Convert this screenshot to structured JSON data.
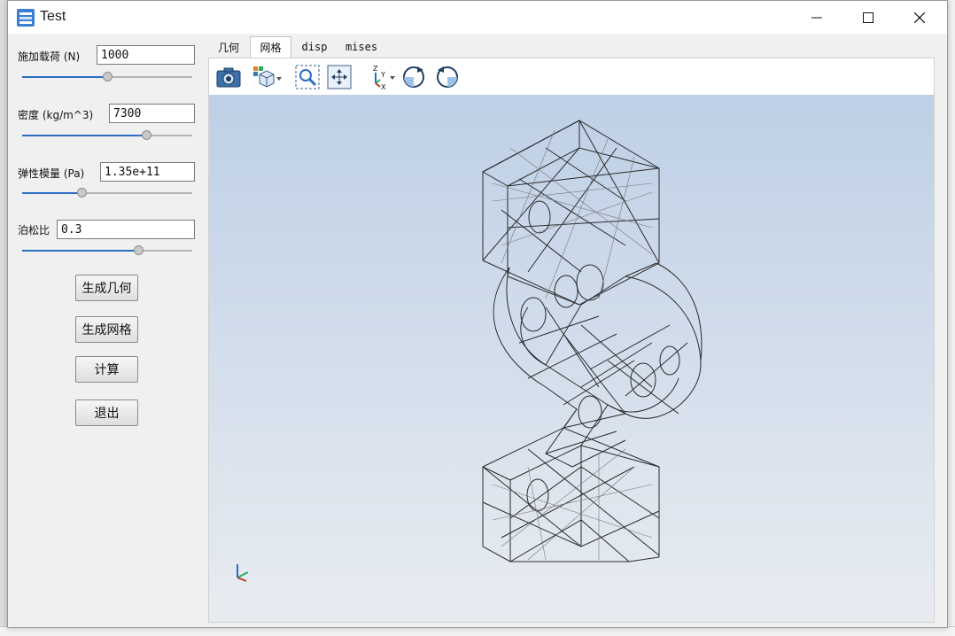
{
  "window": {
    "title": "Test",
    "buttons": {
      "minimize": "minimize-icon",
      "maximize": "maximize-icon",
      "close": "close-icon"
    }
  },
  "params": [
    {
      "label": "施加载荷 (N)",
      "value": "1000",
      "slider_fraction": 0.5
    },
    {
      "label": "密度 (kg/m^3)",
      "value": "7300",
      "slider_fraction": 0.73
    },
    {
      "label": "弹性模量 (Pa)",
      "value": "1.35e+11",
      "slider_fraction": 0.35
    },
    {
      "label": "泊松比",
      "value": "0.3",
      "slider_fraction": 0.68
    }
  ],
  "actions": {
    "gen_geometry": "生成几何",
    "gen_mesh": "生成网格",
    "compute": "计算",
    "exit": "退出"
  },
  "tabs": [
    {
      "label": "几何",
      "active": false
    },
    {
      "label": "网格",
      "active": true
    },
    {
      "label": "disp",
      "active": false
    },
    {
      "label": "mises",
      "active": false
    }
  ],
  "toolbar": [
    "camera-icon",
    "view-cube-icon",
    "zoom-fit-icon",
    "pan-icon",
    "axes-icon",
    "rotate-cw-icon",
    "rotate-ccw-icon"
  ],
  "colors": {
    "accent": "#2b6cc4",
    "viewport_top": "#bed0e6",
    "viewport_bottom": "#e8ecf1"
  }
}
